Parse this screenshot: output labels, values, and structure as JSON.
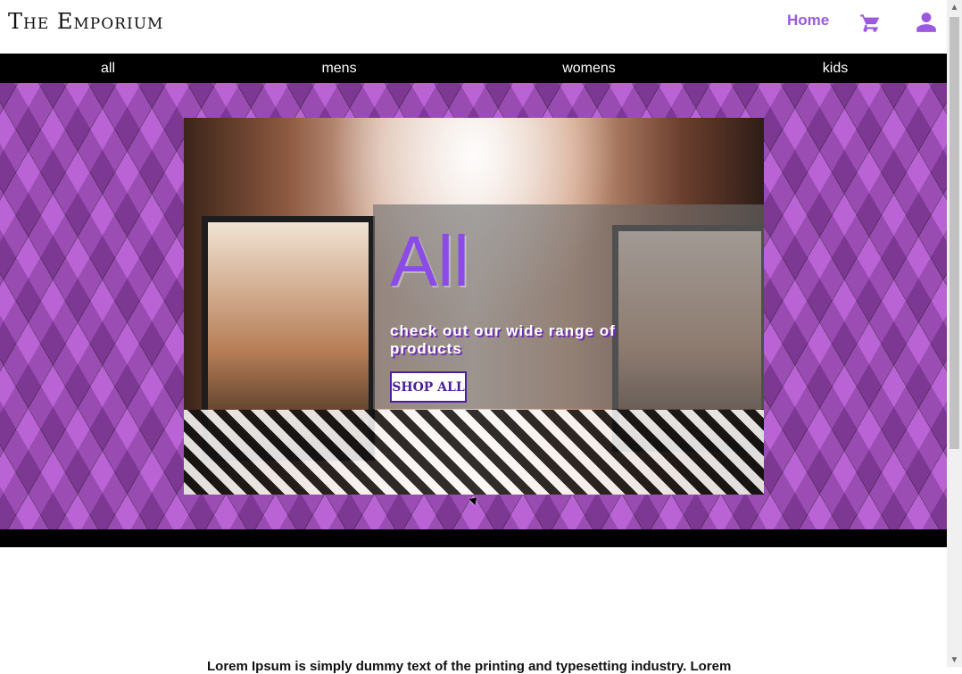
{
  "header": {
    "brand": "The Emporium",
    "home": "Home",
    "icons": [
      "cart-icon",
      "user-icon"
    ],
    "accent": "#9b59e0"
  },
  "categories": {
    "items": [
      "all",
      "mens",
      "womens",
      "kids"
    ]
  },
  "hero": {
    "title": "All",
    "subtitle": "check out our wide range of products",
    "button": "SHOP ALL",
    "accent": "#8b4be6",
    "button_border": "#4b1f9d"
  },
  "content": {
    "lorem": "Lorem Ipsum is simply dummy text of the printing and typesetting industry. Lorem"
  }
}
